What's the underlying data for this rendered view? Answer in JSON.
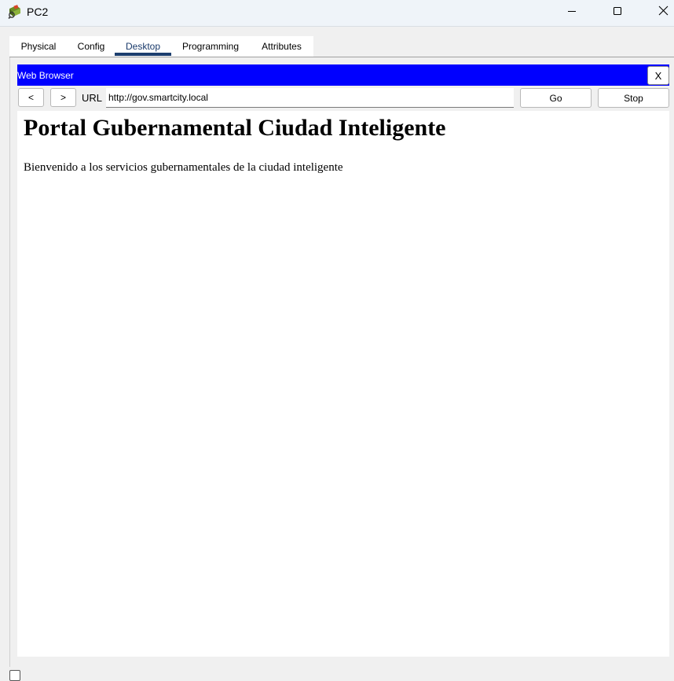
{
  "window": {
    "title": "PC2",
    "icon": "pc-device-icon",
    "controls": {
      "minimize_icon": "minimize-icon",
      "maximize_icon": "maximize-icon",
      "close_icon": "close-icon"
    }
  },
  "tabs": [
    {
      "label": "Physical",
      "active": false
    },
    {
      "label": "Config",
      "active": false
    },
    {
      "label": "Desktop",
      "active": true
    },
    {
      "label": "Programming",
      "active": false
    },
    {
      "label": "Attributes",
      "active": false
    }
  ],
  "browser": {
    "title": "Web Browser",
    "close_label": "X",
    "back_label": "<",
    "forward_label": ">",
    "url_label": "URL",
    "url_value": "http://gov.smartcity.local",
    "go_label": "Go",
    "stop_label": "Stop"
  },
  "page": {
    "heading": "Portal Gubernamental Ciudad Inteligente",
    "paragraph": "Bienvenido a los servicios gubernamentales de la ciudad inteligente"
  },
  "colors": {
    "browser_titlebar": "#0000ff",
    "active_tab_underline": "#1c3e6e",
    "titlebar_bg": "#eff4f9"
  }
}
